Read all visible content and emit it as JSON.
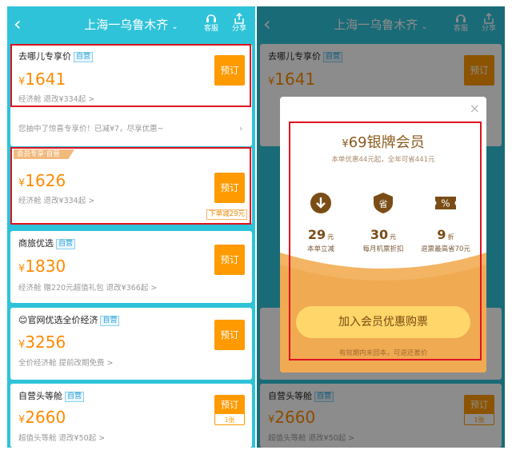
{
  "header": {
    "title": "上海一乌鲁木齐",
    "chevron": "⌄",
    "back_icon": "chevron-left-icon",
    "service_label": "客服",
    "share_label": "分享"
  },
  "flights": [
    {
      "name": "去哪儿专享价",
      "tag": "自营",
      "yen": "¥",
      "price": "1641",
      "sub": "经济舱 退改¥334起 >",
      "button": "预订"
    },
    {
      "ribbon": "会员专享·自营",
      "yen": "¥",
      "price": "1626",
      "sub": "经济舱 退改¥334起 >",
      "button": "预订",
      "discount": "下单减29元"
    },
    {
      "name": "商旅优选",
      "tag": "自营",
      "yen": "¥",
      "price": "1830",
      "sub": "经济舱 赠220元超值礼包 退改¥366起 >",
      "button": "预订"
    },
    {
      "icon": "😊",
      "name": "官网优选全价经济",
      "tag": "自营",
      "yen": "¥",
      "price": "3256",
      "sub": "全价经济舱 提前改期免费 >",
      "button": "预订"
    },
    {
      "name": "自营头等舱",
      "tag": "自营",
      "yen": "¥",
      "price": "2660",
      "sub": "超值头等舱 退改¥50起 >",
      "button": "预订",
      "seats": "1张"
    }
  ],
  "promo": {
    "text": "您抽中了惊喜专享价！已减¥7，尽享优惠~",
    "arrow": "›"
  },
  "modal": {
    "close": "×",
    "yen": "¥",
    "title": "69银牌会员",
    "subtitle": "本单优惠44元起，全年可省441元",
    "features": [
      {
        "icon": "download-badge-icon",
        "value": "29",
        "unit": "元",
        "label": "本单立减"
      },
      {
        "icon": "shield-sheng-icon",
        "value": "30",
        "unit": "元",
        "label": "每月机票折扣"
      },
      {
        "icon": "percent-ticket-icon",
        "value": "9",
        "unit": "折",
        "label": "退票最高省70元"
      }
    ],
    "cta": "加入会员优惠购票",
    "note": "有效期内未回本，可退还差价"
  },
  "colors": {
    "teal": "#2fc3d9",
    "orange": "#ff9a00",
    "red": "#e0121f",
    "gold": "#ffd66a"
  }
}
